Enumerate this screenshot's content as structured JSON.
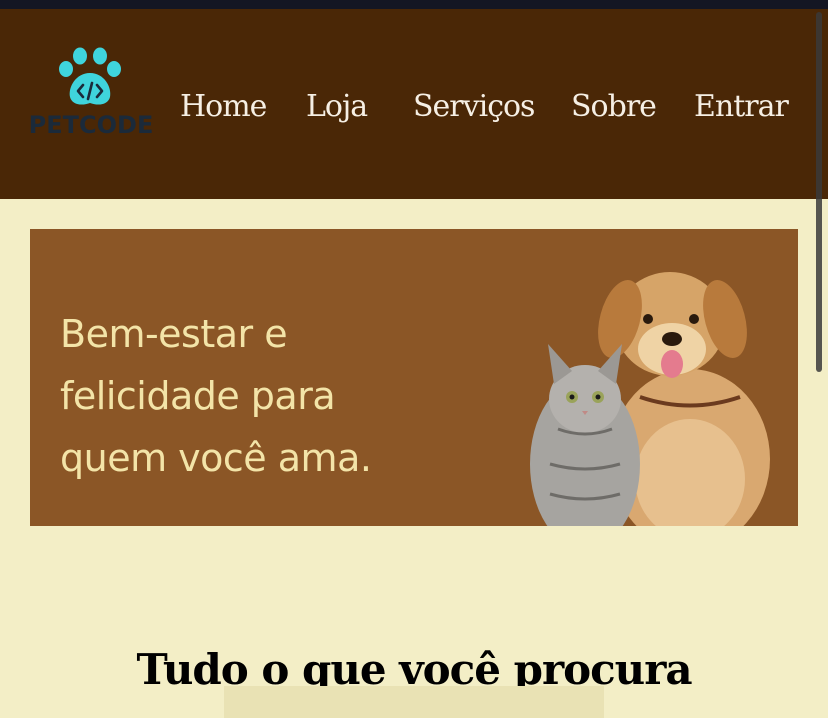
{
  "brand": {
    "name": "PETCODE",
    "logo_icon": "paw-code-icon"
  },
  "nav": {
    "items": [
      {
        "label": "Home"
      },
      {
        "label": "Loja"
      },
      {
        "label": "Serviços"
      },
      {
        "label": "Sobre"
      },
      {
        "label": "Entrar"
      }
    ]
  },
  "hero": {
    "headline_line1": "Bem-estar e",
    "headline_line2": "felicidade para",
    "headline_line3": "quem você ama.",
    "image": "cat-and-dog-illustration"
  },
  "section": {
    "title": "Tudo o que você procura"
  },
  "colors": {
    "header_bg": "#4a2706",
    "page_bg": "#f3eec6",
    "hero_bg": "#8b5626",
    "hero_text": "#f3e4a8",
    "logo_paw": "#3fd4dc",
    "logo_text": "#1b2a3a"
  }
}
